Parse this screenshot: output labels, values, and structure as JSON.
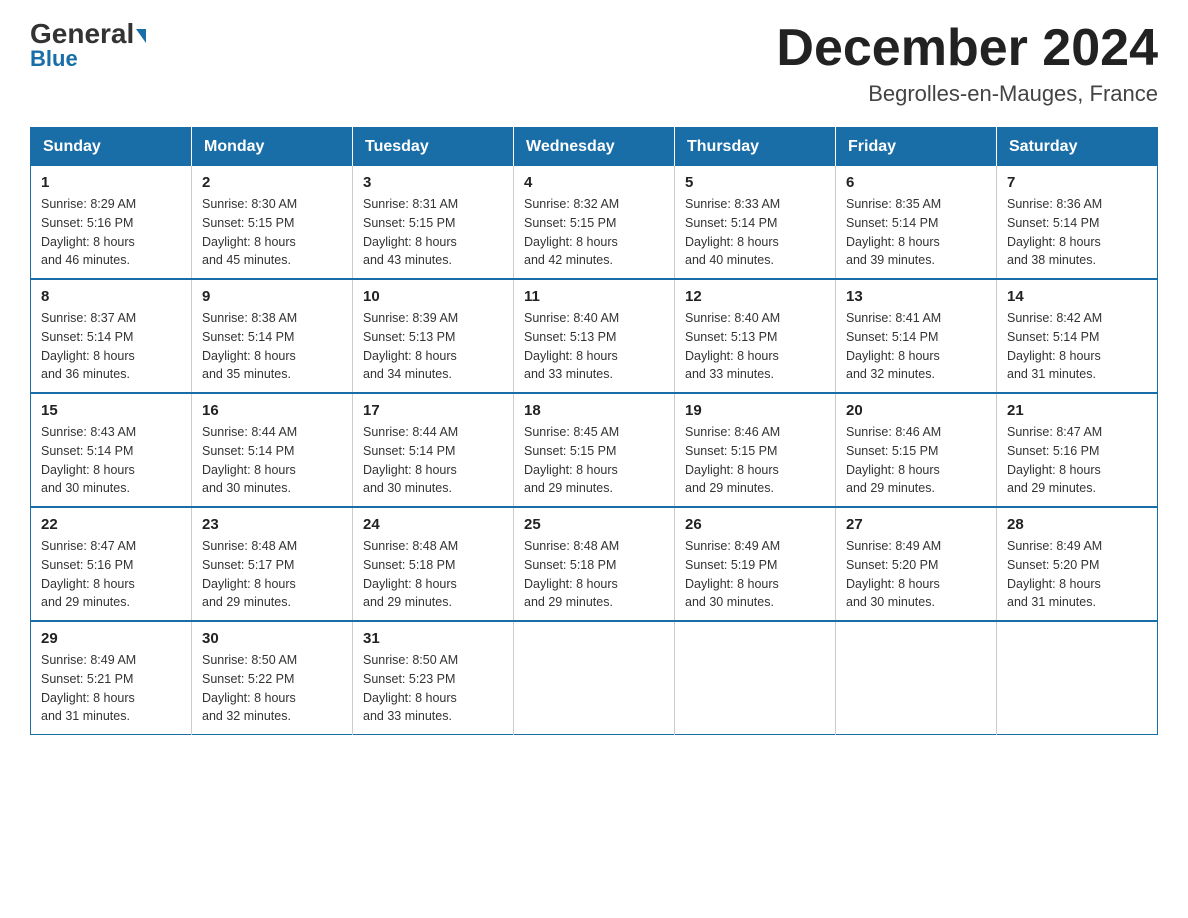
{
  "header": {
    "logo_general": "General",
    "logo_blue": "Blue",
    "month_title": "December 2024",
    "location": "Begrolles-en-Mauges, France"
  },
  "columns": [
    "Sunday",
    "Monday",
    "Tuesday",
    "Wednesday",
    "Thursday",
    "Friday",
    "Saturday"
  ],
  "weeks": [
    [
      {
        "day": "1",
        "sunrise": "8:29 AM",
        "sunset": "5:16 PM",
        "daylight": "8 hours and 46 minutes."
      },
      {
        "day": "2",
        "sunrise": "8:30 AM",
        "sunset": "5:15 PM",
        "daylight": "8 hours and 45 minutes."
      },
      {
        "day": "3",
        "sunrise": "8:31 AM",
        "sunset": "5:15 PM",
        "daylight": "8 hours and 43 minutes."
      },
      {
        "day": "4",
        "sunrise": "8:32 AM",
        "sunset": "5:15 PM",
        "daylight": "8 hours and 42 minutes."
      },
      {
        "day": "5",
        "sunrise": "8:33 AM",
        "sunset": "5:14 PM",
        "daylight": "8 hours and 40 minutes."
      },
      {
        "day": "6",
        "sunrise": "8:35 AM",
        "sunset": "5:14 PM",
        "daylight": "8 hours and 39 minutes."
      },
      {
        "day": "7",
        "sunrise": "8:36 AM",
        "sunset": "5:14 PM",
        "daylight": "8 hours and 38 minutes."
      }
    ],
    [
      {
        "day": "8",
        "sunrise": "8:37 AM",
        "sunset": "5:14 PM",
        "daylight": "8 hours and 36 minutes."
      },
      {
        "day": "9",
        "sunrise": "8:38 AM",
        "sunset": "5:14 PM",
        "daylight": "8 hours and 35 minutes."
      },
      {
        "day": "10",
        "sunrise": "8:39 AM",
        "sunset": "5:13 PM",
        "daylight": "8 hours and 34 minutes."
      },
      {
        "day": "11",
        "sunrise": "8:40 AM",
        "sunset": "5:13 PM",
        "daylight": "8 hours and 33 minutes."
      },
      {
        "day": "12",
        "sunrise": "8:40 AM",
        "sunset": "5:13 PM",
        "daylight": "8 hours and 33 minutes."
      },
      {
        "day": "13",
        "sunrise": "8:41 AM",
        "sunset": "5:14 PM",
        "daylight": "8 hours and 32 minutes."
      },
      {
        "day": "14",
        "sunrise": "8:42 AM",
        "sunset": "5:14 PM",
        "daylight": "8 hours and 31 minutes."
      }
    ],
    [
      {
        "day": "15",
        "sunrise": "8:43 AM",
        "sunset": "5:14 PM",
        "daylight": "8 hours and 30 minutes."
      },
      {
        "day": "16",
        "sunrise": "8:44 AM",
        "sunset": "5:14 PM",
        "daylight": "8 hours and 30 minutes."
      },
      {
        "day": "17",
        "sunrise": "8:44 AM",
        "sunset": "5:14 PM",
        "daylight": "8 hours and 30 minutes."
      },
      {
        "day": "18",
        "sunrise": "8:45 AM",
        "sunset": "5:15 PM",
        "daylight": "8 hours and 29 minutes."
      },
      {
        "day": "19",
        "sunrise": "8:46 AM",
        "sunset": "5:15 PM",
        "daylight": "8 hours and 29 minutes."
      },
      {
        "day": "20",
        "sunrise": "8:46 AM",
        "sunset": "5:15 PM",
        "daylight": "8 hours and 29 minutes."
      },
      {
        "day": "21",
        "sunrise": "8:47 AM",
        "sunset": "5:16 PM",
        "daylight": "8 hours and 29 minutes."
      }
    ],
    [
      {
        "day": "22",
        "sunrise": "8:47 AM",
        "sunset": "5:16 PM",
        "daylight": "8 hours and 29 minutes."
      },
      {
        "day": "23",
        "sunrise": "8:48 AM",
        "sunset": "5:17 PM",
        "daylight": "8 hours and 29 minutes."
      },
      {
        "day": "24",
        "sunrise": "8:48 AM",
        "sunset": "5:18 PM",
        "daylight": "8 hours and 29 minutes."
      },
      {
        "day": "25",
        "sunrise": "8:48 AM",
        "sunset": "5:18 PM",
        "daylight": "8 hours and 29 minutes."
      },
      {
        "day": "26",
        "sunrise": "8:49 AM",
        "sunset": "5:19 PM",
        "daylight": "8 hours and 30 minutes."
      },
      {
        "day": "27",
        "sunrise": "8:49 AM",
        "sunset": "5:20 PM",
        "daylight": "8 hours and 30 minutes."
      },
      {
        "day": "28",
        "sunrise": "8:49 AM",
        "sunset": "5:20 PM",
        "daylight": "8 hours and 31 minutes."
      }
    ],
    [
      {
        "day": "29",
        "sunrise": "8:49 AM",
        "sunset": "5:21 PM",
        "daylight": "8 hours and 31 minutes."
      },
      {
        "day": "30",
        "sunrise": "8:50 AM",
        "sunset": "5:22 PM",
        "daylight": "8 hours and 32 minutes."
      },
      {
        "day": "31",
        "sunrise": "8:50 AM",
        "sunset": "5:23 PM",
        "daylight": "8 hours and 33 minutes."
      },
      null,
      null,
      null,
      null
    ]
  ],
  "labels": {
    "sunrise": "Sunrise:",
    "sunset": "Sunset:",
    "daylight": "Daylight:"
  }
}
